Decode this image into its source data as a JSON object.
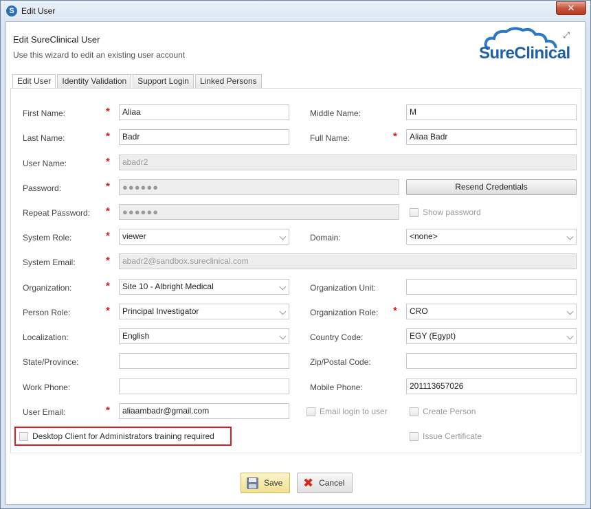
{
  "window": {
    "title": "Edit User",
    "close": "✕"
  },
  "header": {
    "title": "Edit SureClinical User",
    "subtitle": "Use this wizard to edit an existing user account",
    "logo_text": "SureClinical"
  },
  "tabs": [
    "Edit User",
    "Identity Validation",
    "Support Login",
    "Linked Persons"
  ],
  "form": {
    "first_name": {
      "label": "First Name:",
      "value": "Aliaa"
    },
    "middle_name": {
      "label": "Middle Name:",
      "value": "M"
    },
    "last_name": {
      "label": "Last Name:",
      "value": "Badr"
    },
    "full_name": {
      "label": "Full Name:",
      "value": "Aliaa Badr"
    },
    "user_name": {
      "label": "User Name:",
      "value": "abadr2"
    },
    "password": {
      "label": "Password:",
      "value": "●●●●●●"
    },
    "resend_label": "Resend Credentials",
    "repeat_password": {
      "label": "Repeat Password:",
      "value": "●●●●●●"
    },
    "show_password": "Show password",
    "system_role": {
      "label": "System Role:",
      "value": "viewer"
    },
    "domain": {
      "label": "Domain:",
      "value": "<none>"
    },
    "system_email": {
      "label": "System Email:",
      "value": "abadr2@sandbox.sureclinical.com"
    },
    "organization": {
      "label": "Organization:",
      "value": "Site 10 - Albright Medical"
    },
    "organization_unit": {
      "label": "Organization Unit:",
      "value": ""
    },
    "person_role": {
      "label": "Person Role:",
      "value": "Principal Investigator"
    },
    "organization_role": {
      "label": "Organization Role:",
      "value": "CRO"
    },
    "localization": {
      "label": "Localization:",
      "value": "English"
    },
    "country_code": {
      "label": "Country Code:",
      "value": "EGY (Egypt)"
    },
    "state": {
      "label": "State/Province:",
      "value": ""
    },
    "zip": {
      "label": "Zip/Postal Code:",
      "value": ""
    },
    "work_phone": {
      "label": "Work Phone:",
      "value": ""
    },
    "mobile_phone": {
      "label": "Mobile Phone:",
      "value": "201113657026"
    },
    "user_email": {
      "label": "User Email:",
      "value": "aliaambadr@gmail.com"
    },
    "email_login": "Email login to user",
    "create_person": "Create Person",
    "desktop_training": "Desktop Client for Administrators training required",
    "issue_certificate": "Issue Certificate",
    "required_mark": "*"
  },
  "buttons": {
    "save": "Save",
    "cancel": "Cancel"
  },
  "colors": {
    "required": "#e0191e",
    "highlight": "#e11d24",
    "brand": "#1f5fa8"
  }
}
